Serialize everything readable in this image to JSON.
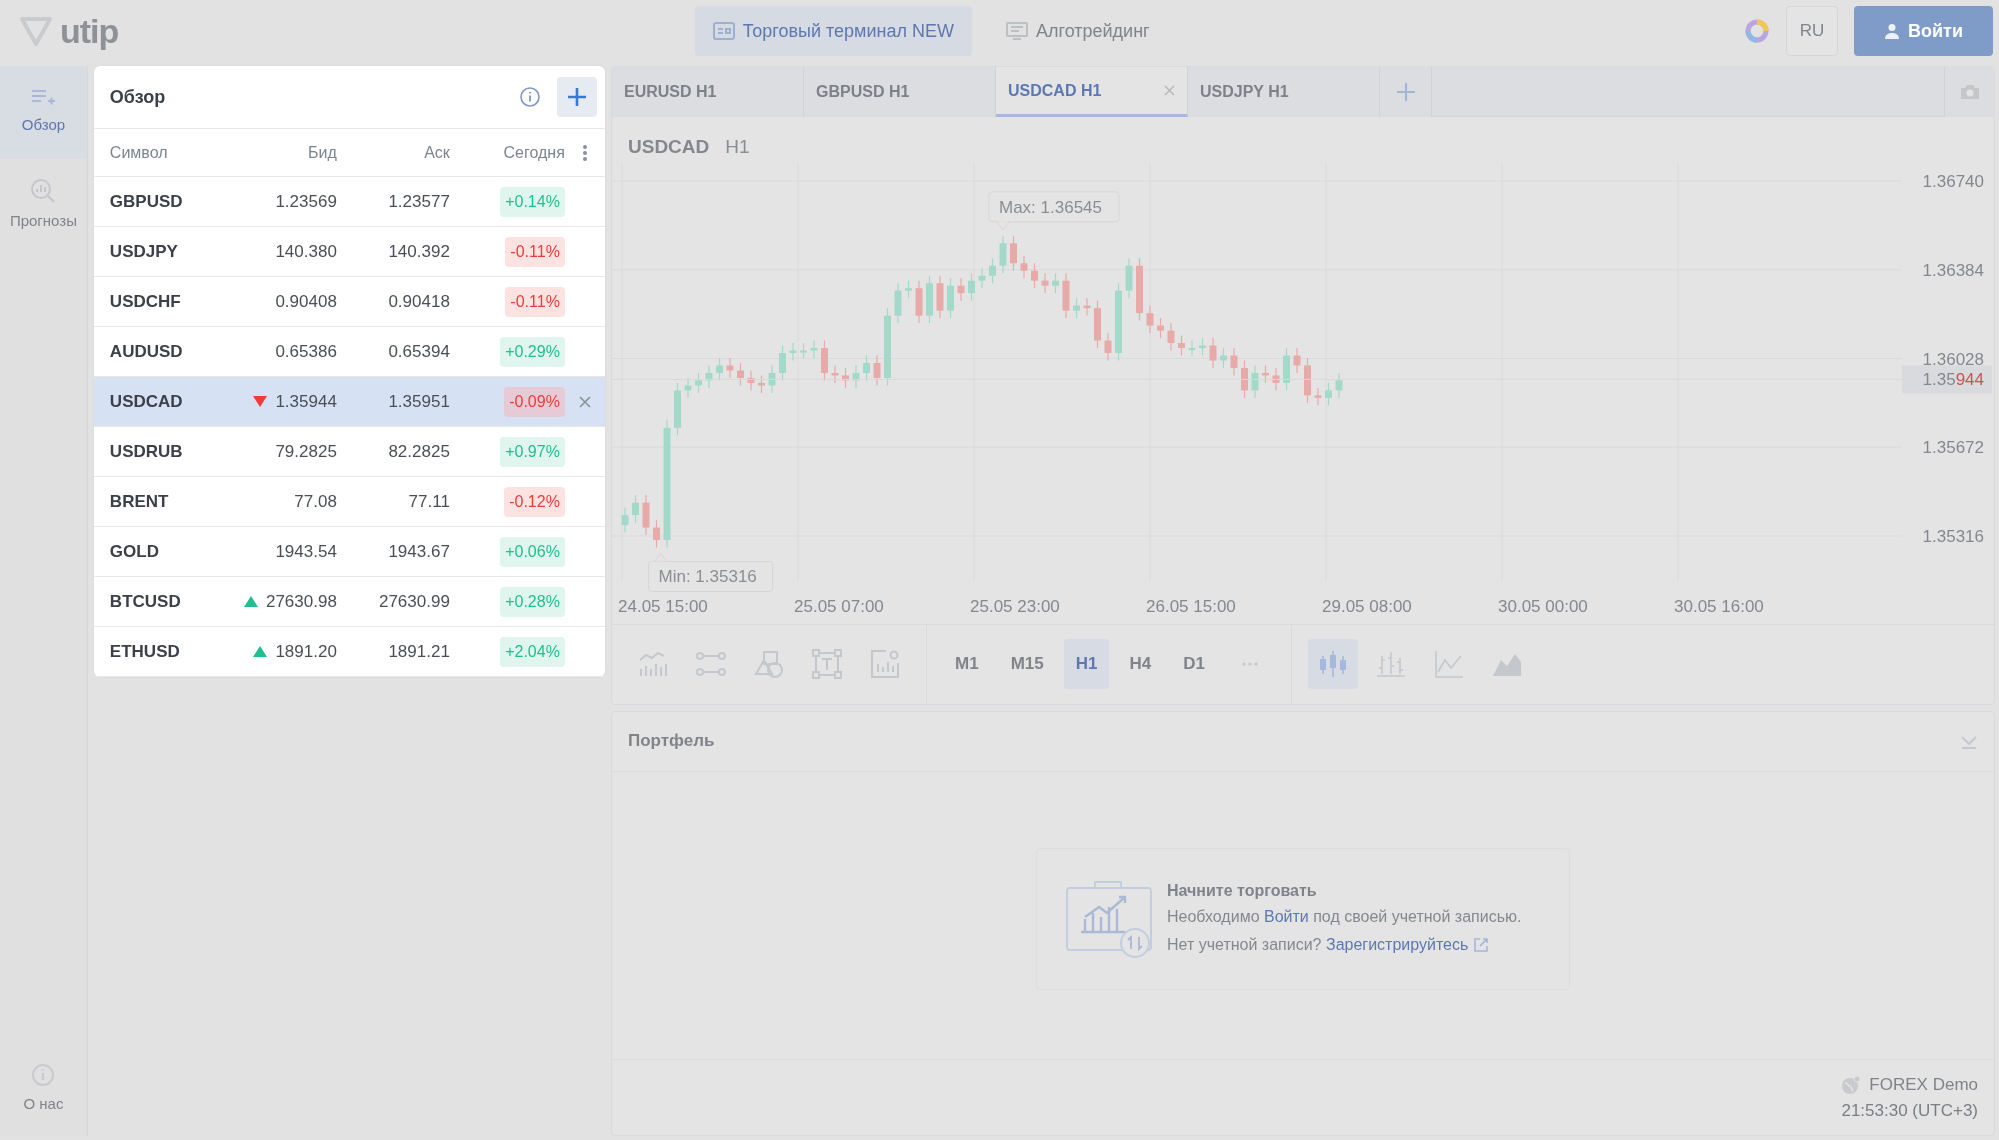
{
  "topbar": {
    "logo": "utip",
    "nav": [
      {
        "label": "Торговый терминал NEW",
        "selected": true,
        "kind": "terminal"
      },
      {
        "label": "Алготрейдинг",
        "selected": false,
        "kind": "algo"
      }
    ],
    "language": "RU",
    "login": "Войти"
  },
  "sidebar": {
    "items": [
      {
        "label": "Обзор",
        "selected": true,
        "kind": "watchlist"
      },
      {
        "label": "Прогнозы",
        "selected": false,
        "kind": "forecast"
      }
    ],
    "footer_item": "О нас"
  },
  "watchlist": {
    "title": "Обзор",
    "columns": [
      "Символ",
      "Бид",
      "Аск",
      "Сегодня"
    ],
    "rows": [
      {
        "symbol": "GBPUSD",
        "bid": "1.23569",
        "ask": "1.23577",
        "change": "+0.14%",
        "falling": false,
        "tick_up": false,
        "tick_down": false,
        "selected": false
      },
      {
        "symbol": "USDJPY",
        "bid": "140.380",
        "ask": "140.392",
        "change": "-0.11%",
        "falling": true,
        "tick_up": false,
        "tick_down": false,
        "selected": false
      },
      {
        "symbol": "USDCHF",
        "bid": "0.90408",
        "ask": "0.90418",
        "change": "-0.11%",
        "falling": true,
        "tick_up": false,
        "tick_down": false,
        "selected": false
      },
      {
        "symbol": "AUDUSD",
        "bid": "0.65386",
        "ask": "0.65394",
        "change": "+0.29%",
        "falling": false,
        "tick_up": false,
        "tick_down": false,
        "selected": false
      },
      {
        "symbol": "USDCAD",
        "bid": "1.35944",
        "ask": "1.35951",
        "change": "-0.09%",
        "falling": true,
        "tick_up": false,
        "tick_down": true,
        "selected": true
      },
      {
        "symbol": "USDRUB",
        "bid": "79.2825",
        "ask": "82.2825",
        "change": "+0.97%",
        "falling": false,
        "tick_up": false,
        "tick_down": false,
        "selected": false
      },
      {
        "symbol": "BRENT",
        "bid": "77.08",
        "ask": "77.11",
        "change": "-0.12%",
        "falling": true,
        "tick_up": false,
        "tick_down": false,
        "selected": false
      },
      {
        "symbol": "GOLD",
        "bid": "1943.54",
        "ask": "1943.67",
        "change": "+0.06%",
        "falling": false,
        "tick_up": false,
        "tick_down": false,
        "selected": false
      },
      {
        "symbol": "BTCUSD",
        "bid": "27630.98",
        "ask": "27630.99",
        "change": "+0.28%",
        "falling": false,
        "tick_up": true,
        "tick_down": false,
        "selected": false
      },
      {
        "symbol": "ETHUSD",
        "bid": "1891.20",
        "ask": "1891.21",
        "change": "+2.04%",
        "falling": false,
        "tick_up": true,
        "tick_down": false,
        "selected": false
      }
    ]
  },
  "chart_tabs": [
    {
      "label": "EURUSD H1",
      "selected": false
    },
    {
      "label": "GBPUSD H1",
      "selected": false
    },
    {
      "label": "USDCAD H1",
      "selected": true
    },
    {
      "label": "USDJPY H1",
      "selected": false
    }
  ],
  "chart": {
    "symbol": "USDCAD",
    "timeframe": "H1",
    "max_label": "Max: 1.36545",
    "min_label": "Min: 1.35316",
    "price_labels": [
      "1.36740",
      "1.36384",
      "1.36028",
      "1.35672",
      "1.35316"
    ],
    "current_price": "1.35944",
    "time_labels": [
      "24.05 15:00",
      "25.05 07:00",
      "25.05 23:00",
      "26.05 15:00",
      "29.05 08:00",
      "30.05 00:00",
      "30.05 16:00"
    ]
  },
  "toolbar": {
    "timeframes": [
      {
        "label": "M1",
        "selected": false
      },
      {
        "label": "M15",
        "selected": false
      },
      {
        "label": "H1",
        "selected": true
      },
      {
        "label": "H4",
        "selected": false
      },
      {
        "label": "D1",
        "selected": false
      }
    ],
    "chart_types": [
      {
        "kind": "candles",
        "selected": true
      },
      {
        "kind": "bars",
        "selected": false
      },
      {
        "kind": "line",
        "selected": false
      },
      {
        "kind": "area",
        "selected": false
      }
    ]
  },
  "portfolio": {
    "title": "Портфель",
    "empty_title": "Начните торговать",
    "login_hint": {
      "before": "Необходимо",
      "link": "Войти",
      "after": "под своей учетной записью."
    },
    "signup_hint": {
      "before": "Нет учетной записи?",
      "link": "Зарегистрируйтесь"
    }
  },
  "status": {
    "server": "FOREX Demo",
    "time": "21:53:30 (UTC+3)"
  }
}
